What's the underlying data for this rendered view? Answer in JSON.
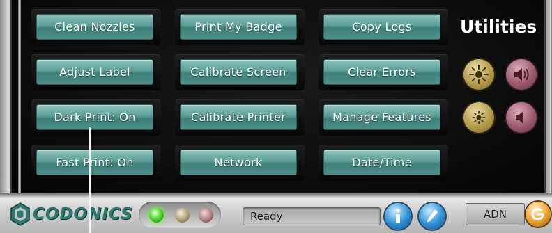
{
  "screen": {
    "title": "Utilities",
    "buttons": [
      [
        "Clean Nozzles",
        "Print My Badge",
        "Copy Logs"
      ],
      [
        "Adjust Label",
        "Calibrate Screen",
        "Clear Errors"
      ],
      [
        "Dark Print: On",
        "Calibrate Printer",
        "Manage Features"
      ],
      [
        "Fast Print: On",
        "Network",
        "Date/Time"
      ]
    ],
    "side_controls": [
      {
        "icon": "brightness-high-icon",
        "color": "#b59b4b"
      },
      {
        "icon": "volume-high-icon",
        "color": "#9c5b6e"
      },
      {
        "icon": "brightness-low-icon",
        "color": "#b59b4b"
      },
      {
        "icon": "volume-low-icon",
        "color": "#9c5b6e"
      }
    ]
  },
  "status_bar": {
    "logo_text": "CODONICS",
    "status_text": "Ready",
    "user": "ADN",
    "leds": [
      {
        "name": "green",
        "color": "#4fdd2f",
        "lit": true
      },
      {
        "name": "tan",
        "color": "#b3a57f",
        "lit": false
      },
      {
        "name": "rose",
        "color": "#b68585",
        "lit": false
      }
    ],
    "icons": [
      "info-icon",
      "help-icon",
      "power-icon"
    ]
  },
  "colors": {
    "button_fill": "#5d9e98",
    "screen_bg": "#0b0b0b",
    "logo": "#2f7a70"
  }
}
